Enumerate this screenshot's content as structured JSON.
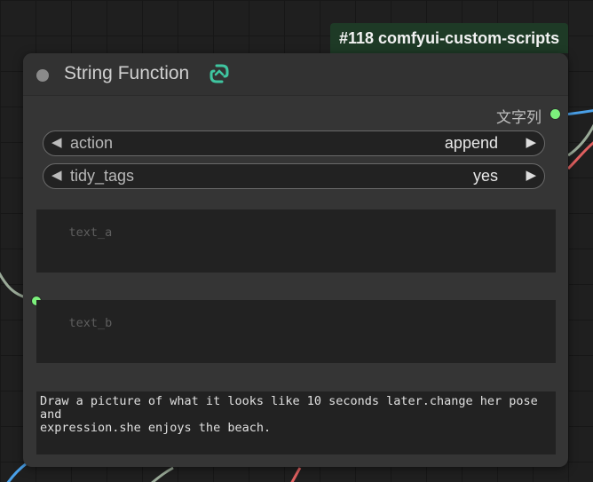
{
  "badge": {
    "text": "#118 comfyui-custom-scripts"
  },
  "node": {
    "title": "String Function",
    "pack_icon": "link-icon",
    "output": {
      "label": "文字列",
      "color": "#7cf07c"
    },
    "widgets": {
      "action": {
        "label": "action",
        "value": "append"
      },
      "tidy_tags": {
        "label": "tidy_tags",
        "value": "yes"
      }
    },
    "text_a": {
      "placeholder": "text_a",
      "value": ""
    },
    "text_b": {
      "placeholder": "text_b",
      "value": ""
    },
    "text_c": {
      "value": "Draw a picture of what it looks like 10 seconds later.change her pose and\nexpression.she enjoys the beach."
    }
  },
  "colors": {
    "canvas": "#1f1f1f",
    "node_body": "#353535",
    "badge": "#1e3a26",
    "link_green": "#7cf07c",
    "link_blue": "#4aa0e8",
    "link_red": "#e06060",
    "link_grey": "#9aaa98"
  }
}
